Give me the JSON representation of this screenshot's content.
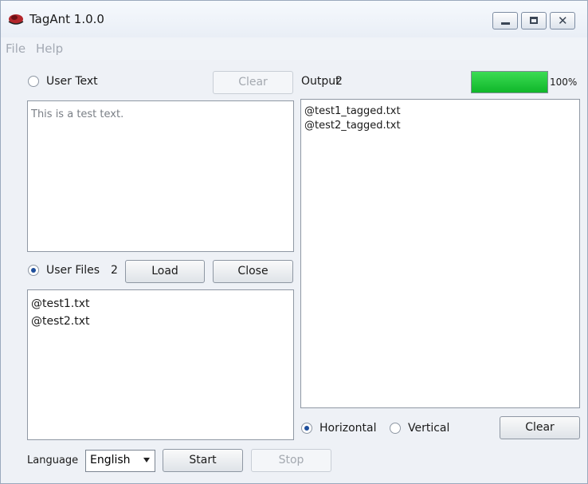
{
  "app": {
    "title": "TagAnt 1.0.0"
  },
  "menu": {
    "items": [
      "File",
      "Help"
    ]
  },
  "user_text": {
    "label": "User Text",
    "clear_label": "Clear",
    "content": "This is a test text."
  },
  "user_files": {
    "label": "User Files",
    "count": "2",
    "load_label": "Load",
    "close_label": "Close",
    "files": [
      "@test1.txt",
      "@test2.txt"
    ]
  },
  "output": {
    "label": "Output",
    "count": "2",
    "progress_text": "100%",
    "progress_value": 100,
    "files": [
      "@test1_tagged.txt",
      "@test2_tagged.txt"
    ],
    "horizontal_label": "Horizontal",
    "vertical_label": "Vertical",
    "clear_label": "Clear"
  },
  "language": {
    "label": "Language",
    "selected": "English"
  },
  "actions": {
    "start_label": "Start",
    "stop_label": "Stop"
  },
  "colors": {
    "progress_fill": "#17c232",
    "radio_selected": "#1f4f9c"
  }
}
